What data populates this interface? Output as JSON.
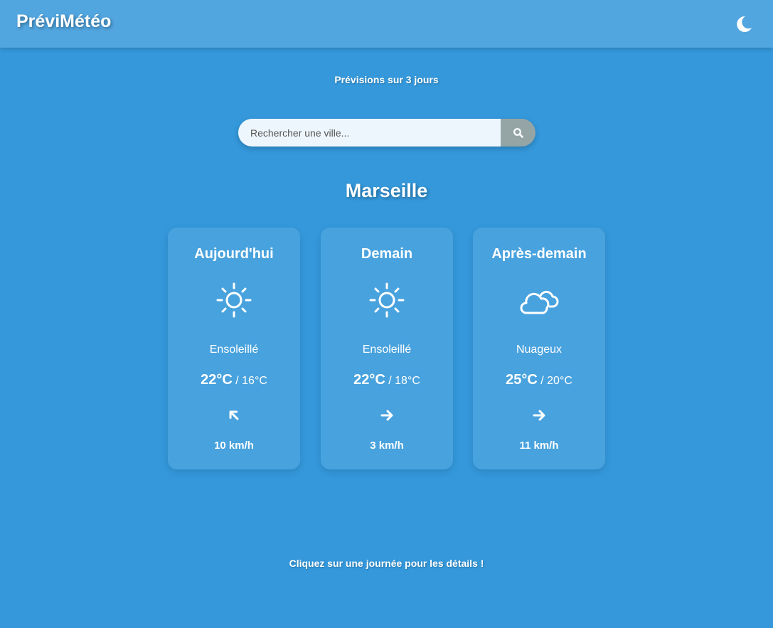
{
  "header": {
    "brand": "PréviMétéo",
    "theme_toggle_icon": "moon-icon"
  },
  "subtitle": "Prévisions sur 3 jours",
  "search": {
    "placeholder": "Rechercher une ville...",
    "value": "",
    "button_icon": "search-icon"
  },
  "city": "Marseille",
  "days": [
    {
      "label": "Aujourd'hui",
      "icon": "sun-icon",
      "condition": "Ensoleillé",
      "tmax": "22°C",
      "separator": " / ",
      "tmin": "16°C",
      "wind_icon": "wind-direction-arrow-icon",
      "wind_direction_deg": -45,
      "wind_speed": "10 km/h"
    },
    {
      "label": "Demain",
      "icon": "sun-icon",
      "condition": "Ensoleillé",
      "tmax": "22°C",
      "separator": " / ",
      "tmin": "18°C",
      "wind_icon": "wind-direction-arrow-icon",
      "wind_direction_deg": 90,
      "wind_speed": "3 km/h"
    },
    {
      "label": "Après-demain",
      "icon": "cloud-icon",
      "condition": "Nuageux",
      "tmax": "25°C",
      "separator": " / ",
      "tmin": "20°C",
      "wind_icon": "wind-direction-arrow-icon",
      "wind_direction_deg": 90,
      "wind_speed": "11 km/h"
    }
  ],
  "footer": "Cliquez sur une journée pour les détails !",
  "colors": {
    "background": "#3498db",
    "topbar": "#52a6e0",
    "search_button": "#95a5a6",
    "text": "#ffffff"
  }
}
